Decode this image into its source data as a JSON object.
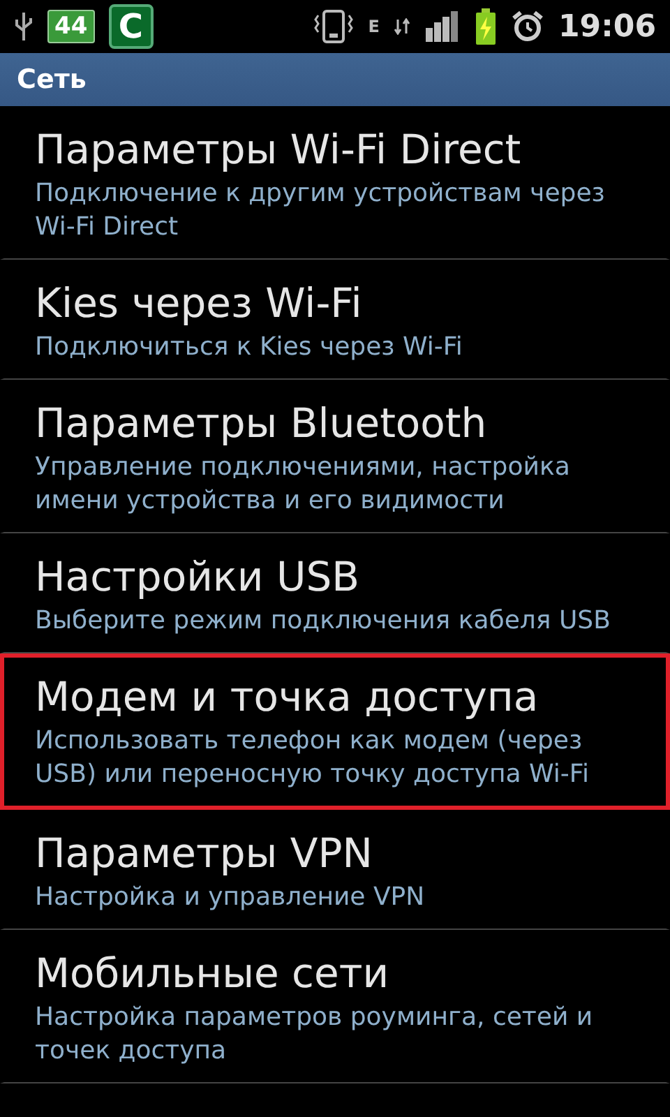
{
  "status_bar": {
    "battery_badge": "44",
    "app_badge": "C",
    "network_type": "E",
    "time": "19:06"
  },
  "header": {
    "title": "Сеть"
  },
  "items": [
    {
      "title": "Параметры Wi-Fi Direct",
      "subtitle": "Подключение к другим устройствам через Wi-Fi Direct",
      "selected": false
    },
    {
      "title": "Kies через Wi-Fi",
      "subtitle": "Подключиться к Kies через Wi-Fi",
      "selected": false
    },
    {
      "title": "Параметры Bluetooth",
      "subtitle": "Управление подключениями, настройка имени устройства и его видимости",
      "selected": false
    },
    {
      "title": "Настройки USB",
      "subtitle": "Выберите режим подключения кабеля USB",
      "selected": false
    },
    {
      "title": "Модем и точка доступа",
      "subtitle": "Использовать телефон как модем (через USB) или переносную точку доступа Wi-Fi",
      "selected": true
    },
    {
      "title": "Параметры VPN",
      "subtitle": "Настройка и управление VPN",
      "selected": false
    },
    {
      "title": "Мобильные сети",
      "subtitle": "Настройка параметров роуминга, сетей и точек доступа",
      "selected": false
    }
  ]
}
